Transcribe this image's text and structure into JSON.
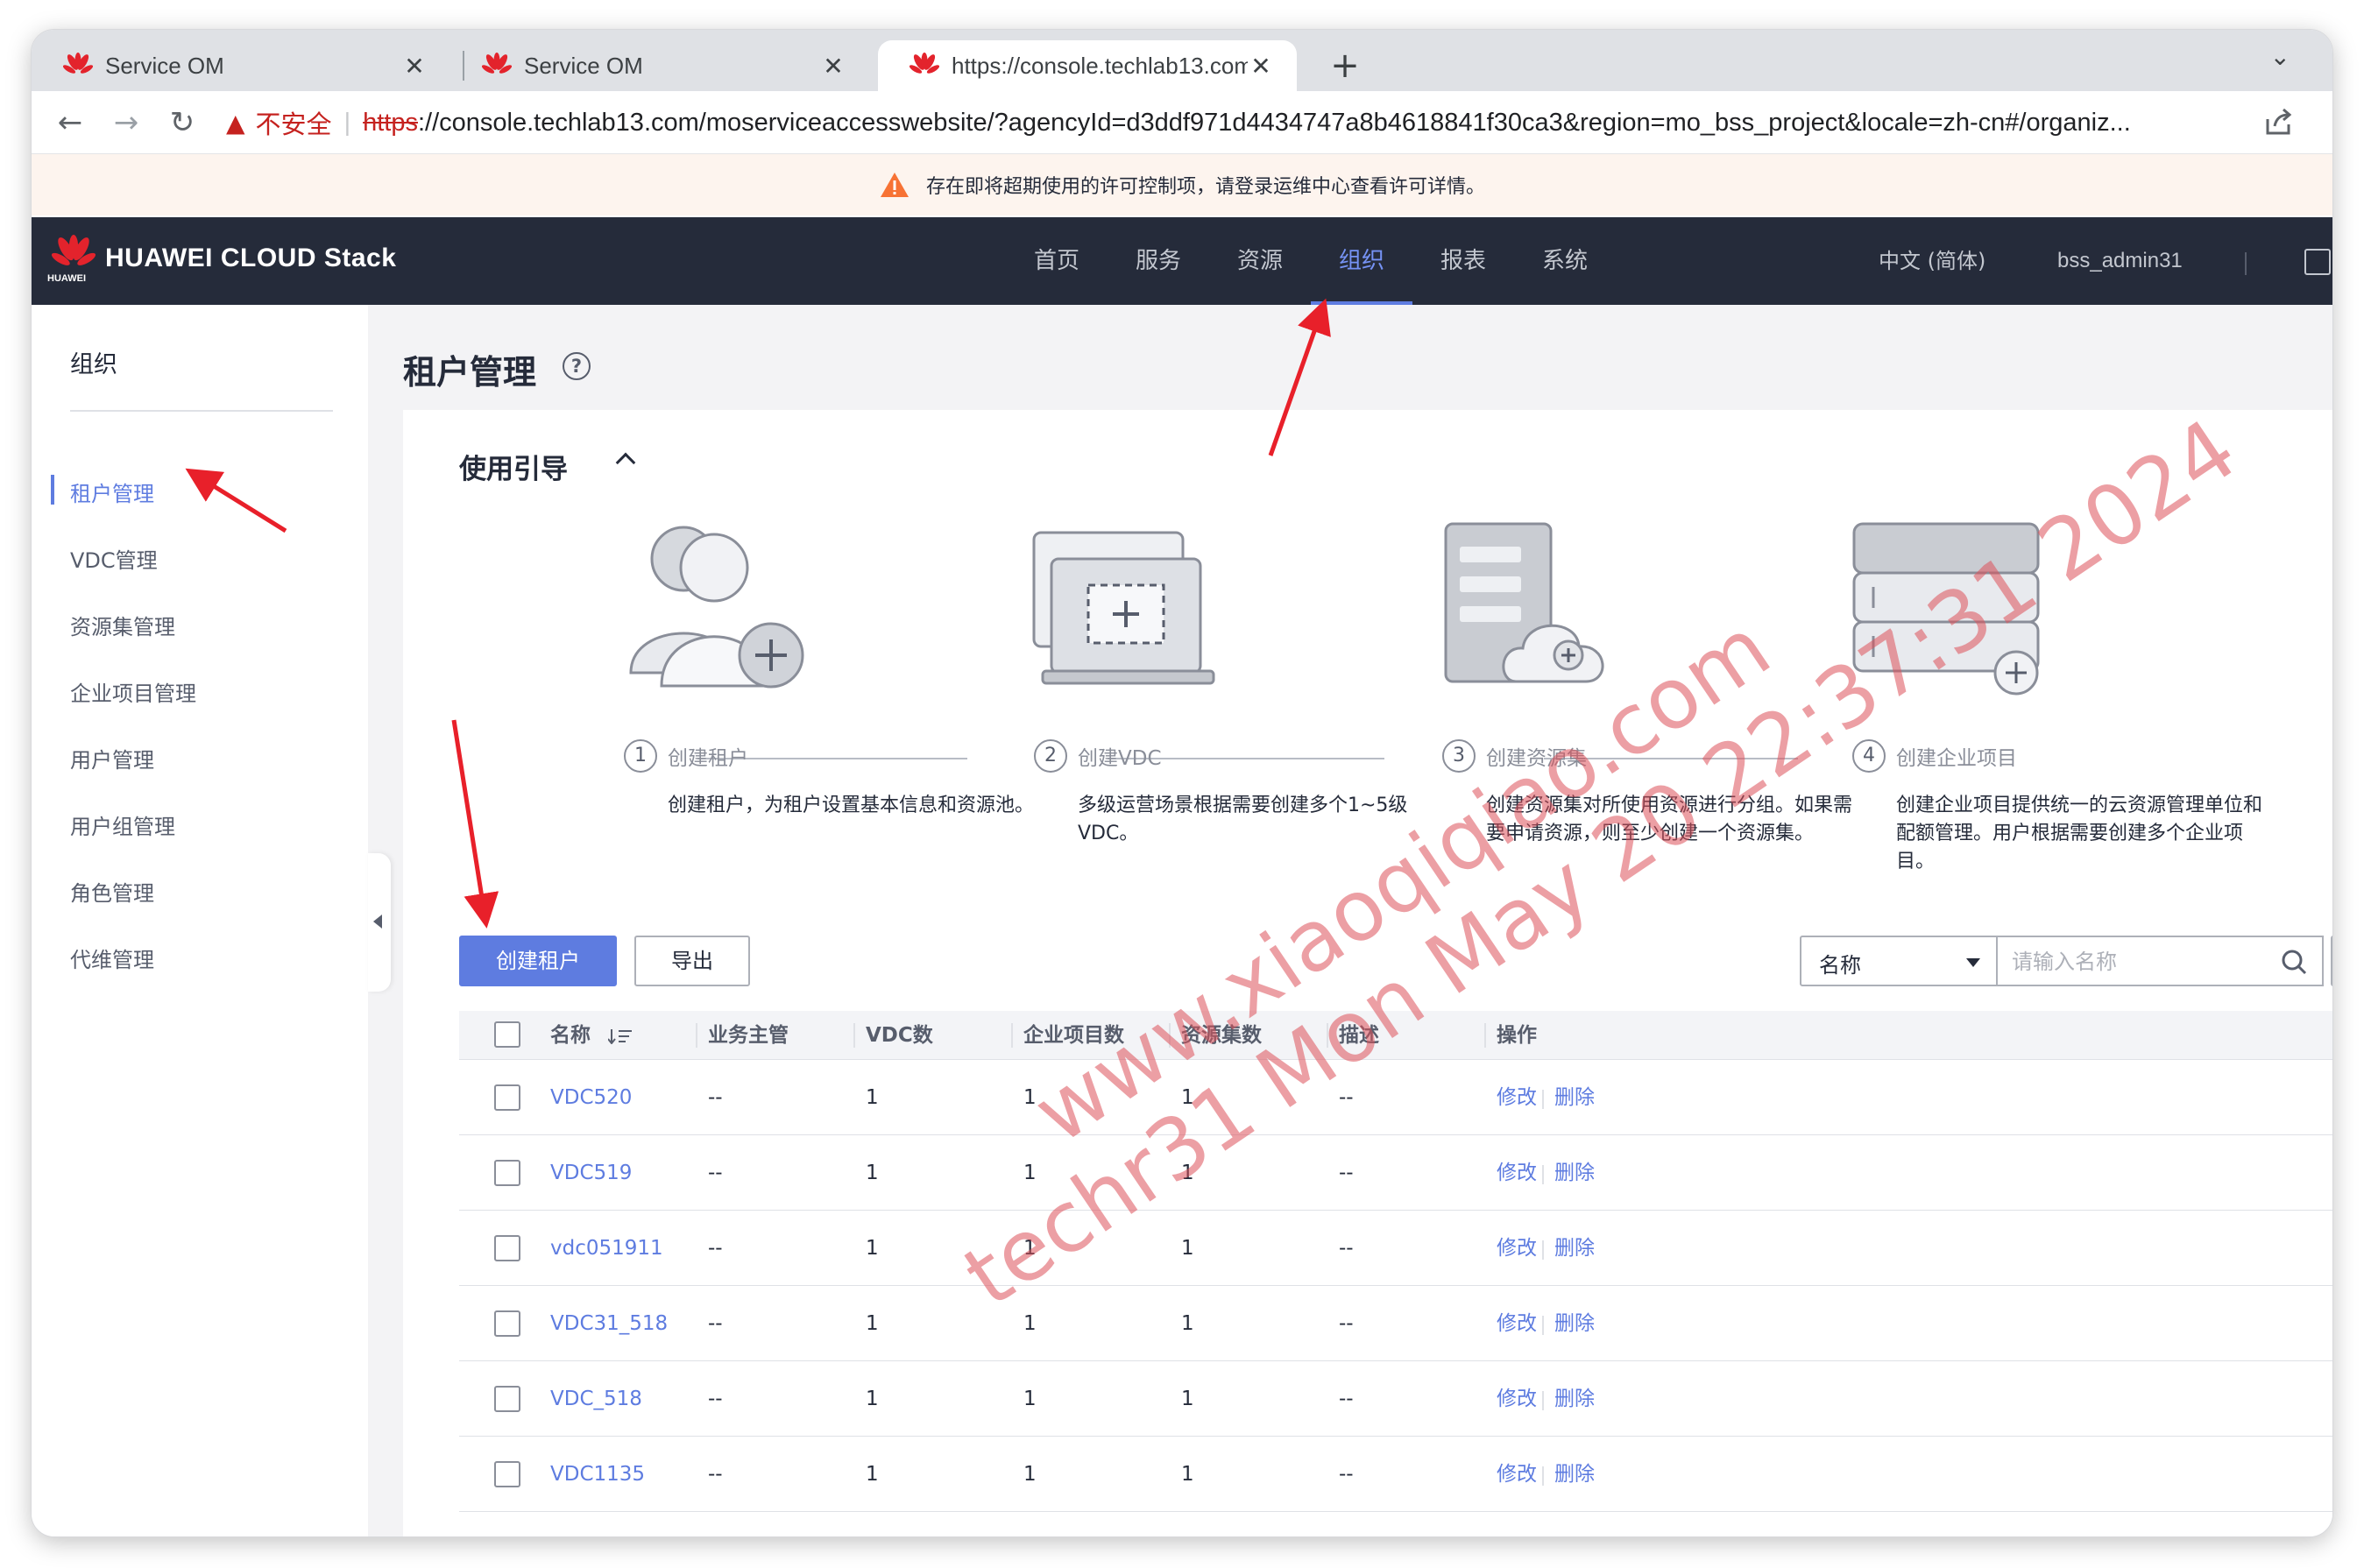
{
  "browser": {
    "tabs": [
      {
        "title": "Service OM",
        "active": false
      },
      {
        "title": "Service OM",
        "active": false
      },
      {
        "title": "https://console.techlab13.com",
        "active": true
      }
    ],
    "new_tab": "+",
    "close_glyph": "✕",
    "address": {
      "security_label": "不安全",
      "scheme": "https",
      "rest": "://console.techlab13.com/moserviceaccesswebsite/?agencyId=d3ddf971d4434747a8b4618841f30ca3&region=mo_bss_project&locale=zh-cn#/organiz..."
    }
  },
  "notice": {
    "text": "存在即将超期使用的许可控制项，请登录运维中心查看许可详情。",
    "icon": "warning-triangle-icon"
  },
  "header": {
    "brand": "HUAWEI CLOUD Stack",
    "logo_small": "HUAWEI",
    "nav": [
      {
        "label": "首页",
        "active": false
      },
      {
        "label": "服务",
        "active": false
      },
      {
        "label": "资源",
        "active": false
      },
      {
        "label": "组织",
        "active": true
      },
      {
        "label": "报表",
        "active": false
      },
      {
        "label": "系统",
        "active": false
      }
    ],
    "language": "中文 (简体)",
    "username": "bss_admin31"
  },
  "sidebar": {
    "title": "组织",
    "items": [
      {
        "label": "租户管理",
        "active": true
      },
      {
        "label": "VDC管理",
        "active": false
      },
      {
        "label": "资源集管理",
        "active": false
      },
      {
        "label": "企业项目管理",
        "active": false
      },
      {
        "label": "用户管理",
        "active": false
      },
      {
        "label": "用户组管理",
        "active": false
      },
      {
        "label": "角色管理",
        "active": false
      },
      {
        "label": "代维管理",
        "active": false
      }
    ]
  },
  "page": {
    "title": "租户管理",
    "help_glyph": "?"
  },
  "guide": {
    "title": "使用引导",
    "steps": [
      {
        "num": "1",
        "label": "创建租户",
        "desc": "创建租户，为租户设置基本信息和资源池。",
        "illustration": "users-add-icon"
      },
      {
        "num": "2",
        "label": "创建VDC",
        "desc": "多级运营场景根据需要创建多个1~5级VDC。",
        "illustration": "laptop-add-icon"
      },
      {
        "num": "3",
        "label": "创建资源集",
        "desc": "创建资源集对所使用资源进行分组。如果需要申请资源，则至少创建一个资源集。",
        "illustration": "server-cloud-icon"
      },
      {
        "num": "4",
        "label": "创建企业项目",
        "desc": "创建企业项目提供统一的云资源管理单位和配额管理。用户根据需要创建多个企业项目。",
        "illustration": "database-add-icon"
      }
    ]
  },
  "actions": {
    "create": "创建租户",
    "export": "导出"
  },
  "filter": {
    "field": "名称",
    "placeholder": "请输入名称"
  },
  "table": {
    "columns": [
      "名称",
      "业务主管",
      "VDC数",
      "企业项目数",
      "资源集数",
      "描述",
      "操作"
    ],
    "rows": [
      {
        "name": "VDC520",
        "manager": "--",
        "vdc": "1",
        "projects": "1",
        "resource_sets": "1",
        "desc": "--"
      },
      {
        "name": "VDC519",
        "manager": "--",
        "vdc": "1",
        "projects": "1",
        "resource_sets": "1",
        "desc": "--"
      },
      {
        "name": "vdc051911",
        "manager": "--",
        "vdc": "1",
        "projects": "1",
        "resource_sets": "1",
        "desc": "--"
      },
      {
        "name": "VDC31_518",
        "manager": "--",
        "vdc": "1",
        "projects": "1",
        "resource_sets": "1",
        "desc": "--"
      },
      {
        "name": "VDC_518",
        "manager": "--",
        "vdc": "1",
        "projects": "1",
        "resource_sets": "1",
        "desc": "--"
      },
      {
        "name": "VDC1135",
        "manager": "--",
        "vdc": "1",
        "projects": "1",
        "resource_sets": "1",
        "desc": "--"
      }
    ],
    "op_edit": "修改",
    "op_delete": "删除"
  },
  "watermark": {
    "line1": "www.xiaoqiqiao.com",
    "line2": "techr31 Mon May 20 22:37:31 2024"
  },
  "colors": {
    "accent": "#5e7ce0",
    "header_bg": "#252b3a",
    "arrow": "#e8202a",
    "notice_bg": "#fdf4ee"
  }
}
